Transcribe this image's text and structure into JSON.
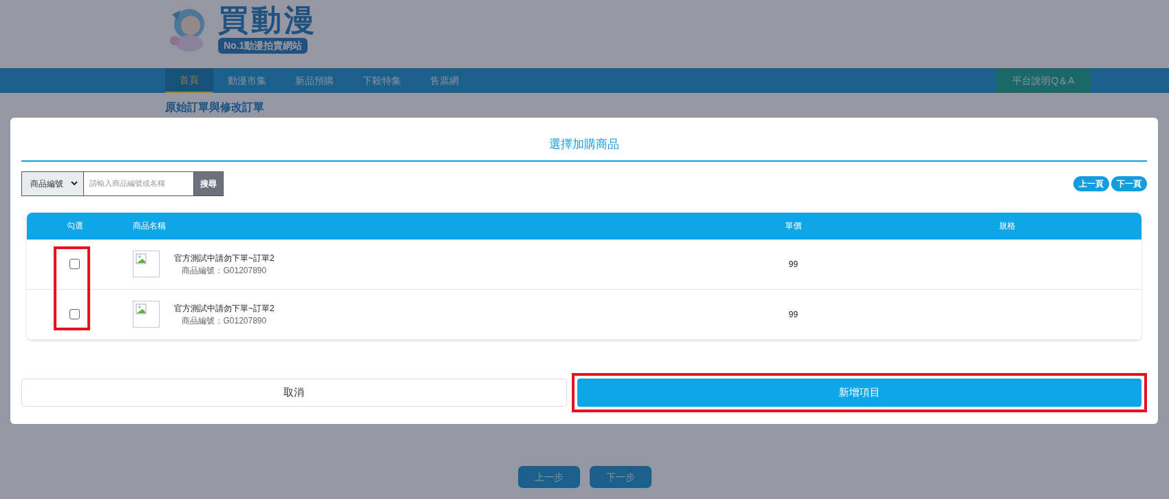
{
  "site": {
    "logo_title": "買動漫",
    "logo_tagline": "No.1動漫拍賣網站"
  },
  "nav": {
    "items": [
      {
        "label": "首頁",
        "selected": true
      },
      {
        "label": "動漫市集",
        "selected": false
      },
      {
        "label": "新品預購",
        "selected": false
      },
      {
        "label": "下殺特集",
        "selected": false
      },
      {
        "label": "售票網",
        "selected": false
      }
    ],
    "help_button": "平台說明Q＆A"
  },
  "page_title": "原始訂單與修改訂單",
  "steps": [
    "上一步",
    "下一步"
  ],
  "modal": {
    "title": "選擇加購商品",
    "search": {
      "field_select": "商品編號",
      "placeholder": "請輸入商品編號或名稱",
      "button": "搜尋"
    },
    "pager": [
      "上一頁",
      "下一頁"
    ],
    "table": {
      "columns": [
        "勾選",
        "商品名稱",
        "單價",
        "規格"
      ],
      "checkbox_column_highlighted": true,
      "rows": [
        {
          "checked": false,
          "name": "官方測試中請勿下單~訂單2",
          "code": "商品編號：G01207890",
          "price": "99"
        },
        {
          "checked": false,
          "name": "官方測試中請勿下單~訂單2",
          "code": "商品編號：G01207890",
          "price": "99"
        }
      ]
    },
    "buttons": [
      {
        "label": "取消",
        "kind": "secondary",
        "highlighted": false
      },
      {
        "label": "新增項目",
        "kind": "primary",
        "highlighted": true
      }
    ]
  }
}
